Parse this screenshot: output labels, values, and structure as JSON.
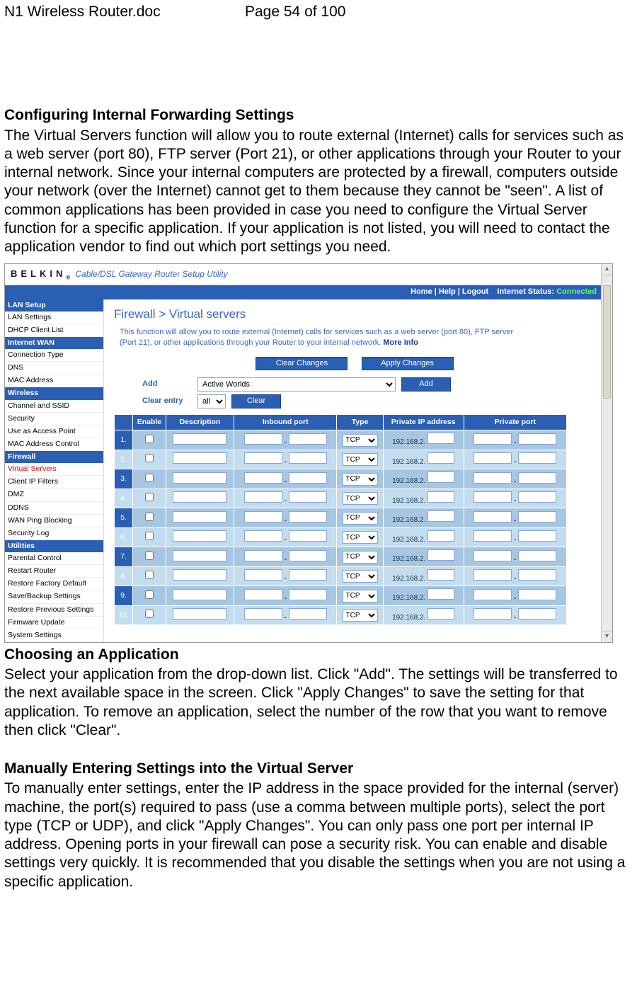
{
  "header": {
    "filename": "N1 Wireless Router.doc",
    "page_info": "Page 54 of 100"
  },
  "sections": {
    "s1_title": "Configuring Internal Forwarding Settings",
    "s1_body": "The Virtual Servers function will allow you to route external (Internet) calls for services such as a web server (port 80), FTP server (Port 21), or other applications through your Router to your internal network. Since your internal computers are protected by a firewall, computers outside your network (over the Internet) cannot get to them because they cannot be \"seen\". A list of common applications has been provided in case you need to configure the Virtual Server function for a specific application. If your application is not listed, you will need to contact the application vendor to find out which port settings you need.",
    "s2_title": "Choosing an Application",
    "s2_body": "Select your application from the drop-down list. Click \"Add\". The settings will be transferred to the next available space in the screen. Click \"Apply Changes\" to save the setting for that application. To remove an application, select the number of the row that you want to remove then click \"Clear\".",
    "s3_title": "Manually Entering Settings into the Virtual Server",
    "s3_body": "To manually enter settings, enter the IP address in the space provided for the internal (server) machine, the port(s) required to pass (use a comma between multiple ports), select the port type (TCP or UDP), and click \"Apply Changes\". You can only pass one port per internal IP address. Opening ports in your firewall can pose a security risk. You can enable and disable settings very quickly. It is recommended that you disable the settings when you are not using a specific application."
  },
  "router": {
    "brand": "BELKIN",
    "brand_sub": "®",
    "subtitle": "Cable/DSL Gateway Router Setup Utility",
    "topnav": {
      "links": "Home | Help | Logout",
      "status_label": "Internet Status:",
      "status_value": "Connected"
    },
    "sidebar": {
      "groups": [
        {
          "title": "LAN Setup",
          "items": [
            "LAN Settings",
            "DHCP Client List"
          ]
        },
        {
          "title": "Internet WAN",
          "items": [
            "Connection Type",
            "DNS",
            "MAC Address"
          ]
        },
        {
          "title": "Wireless",
          "items": [
            "Channel and SSID",
            "Security",
            "Use as Access Point",
            "MAC Address Control"
          ]
        },
        {
          "title": "Firewall",
          "items": [
            "Virtual Servers",
            "Client IP Filters",
            "DMZ",
            "DDNS",
            "WAN Ping Blocking",
            "Security Log"
          ],
          "active_index": 0
        },
        {
          "title": "Utilities",
          "items": [
            "Parental Control",
            "Restart Router",
            "Restore Factory Default",
            "Save/Backup Settings",
            "Restore Previous Settings",
            "Firmware Update",
            "System Settings"
          ]
        }
      ]
    },
    "page": {
      "title": "Firewall > Virtual servers",
      "desc": "This function will allow you to route external (Internet) calls for services such as a web server (port 80), FTP server (Port 21), or other applications through your Router to your internal network.",
      "more_info": "More Info",
      "btn_clear_changes": "Clear Changes",
      "btn_apply_changes": "Apply Changes",
      "add_label": "Add",
      "add_select_value": "Active Worlds",
      "add_btn": "Add",
      "clear_label": "Clear entry",
      "clear_select_value": "all",
      "clear_btn": "Clear",
      "table": {
        "headers": [
          "",
          "Enable",
          "Description",
          "Inbound port",
          "Type",
          "Private IP address",
          "Private port"
        ],
        "type_value": "TCP",
        "ip_prefix": "192.168.2.",
        "row_count": 10
      }
    }
  }
}
